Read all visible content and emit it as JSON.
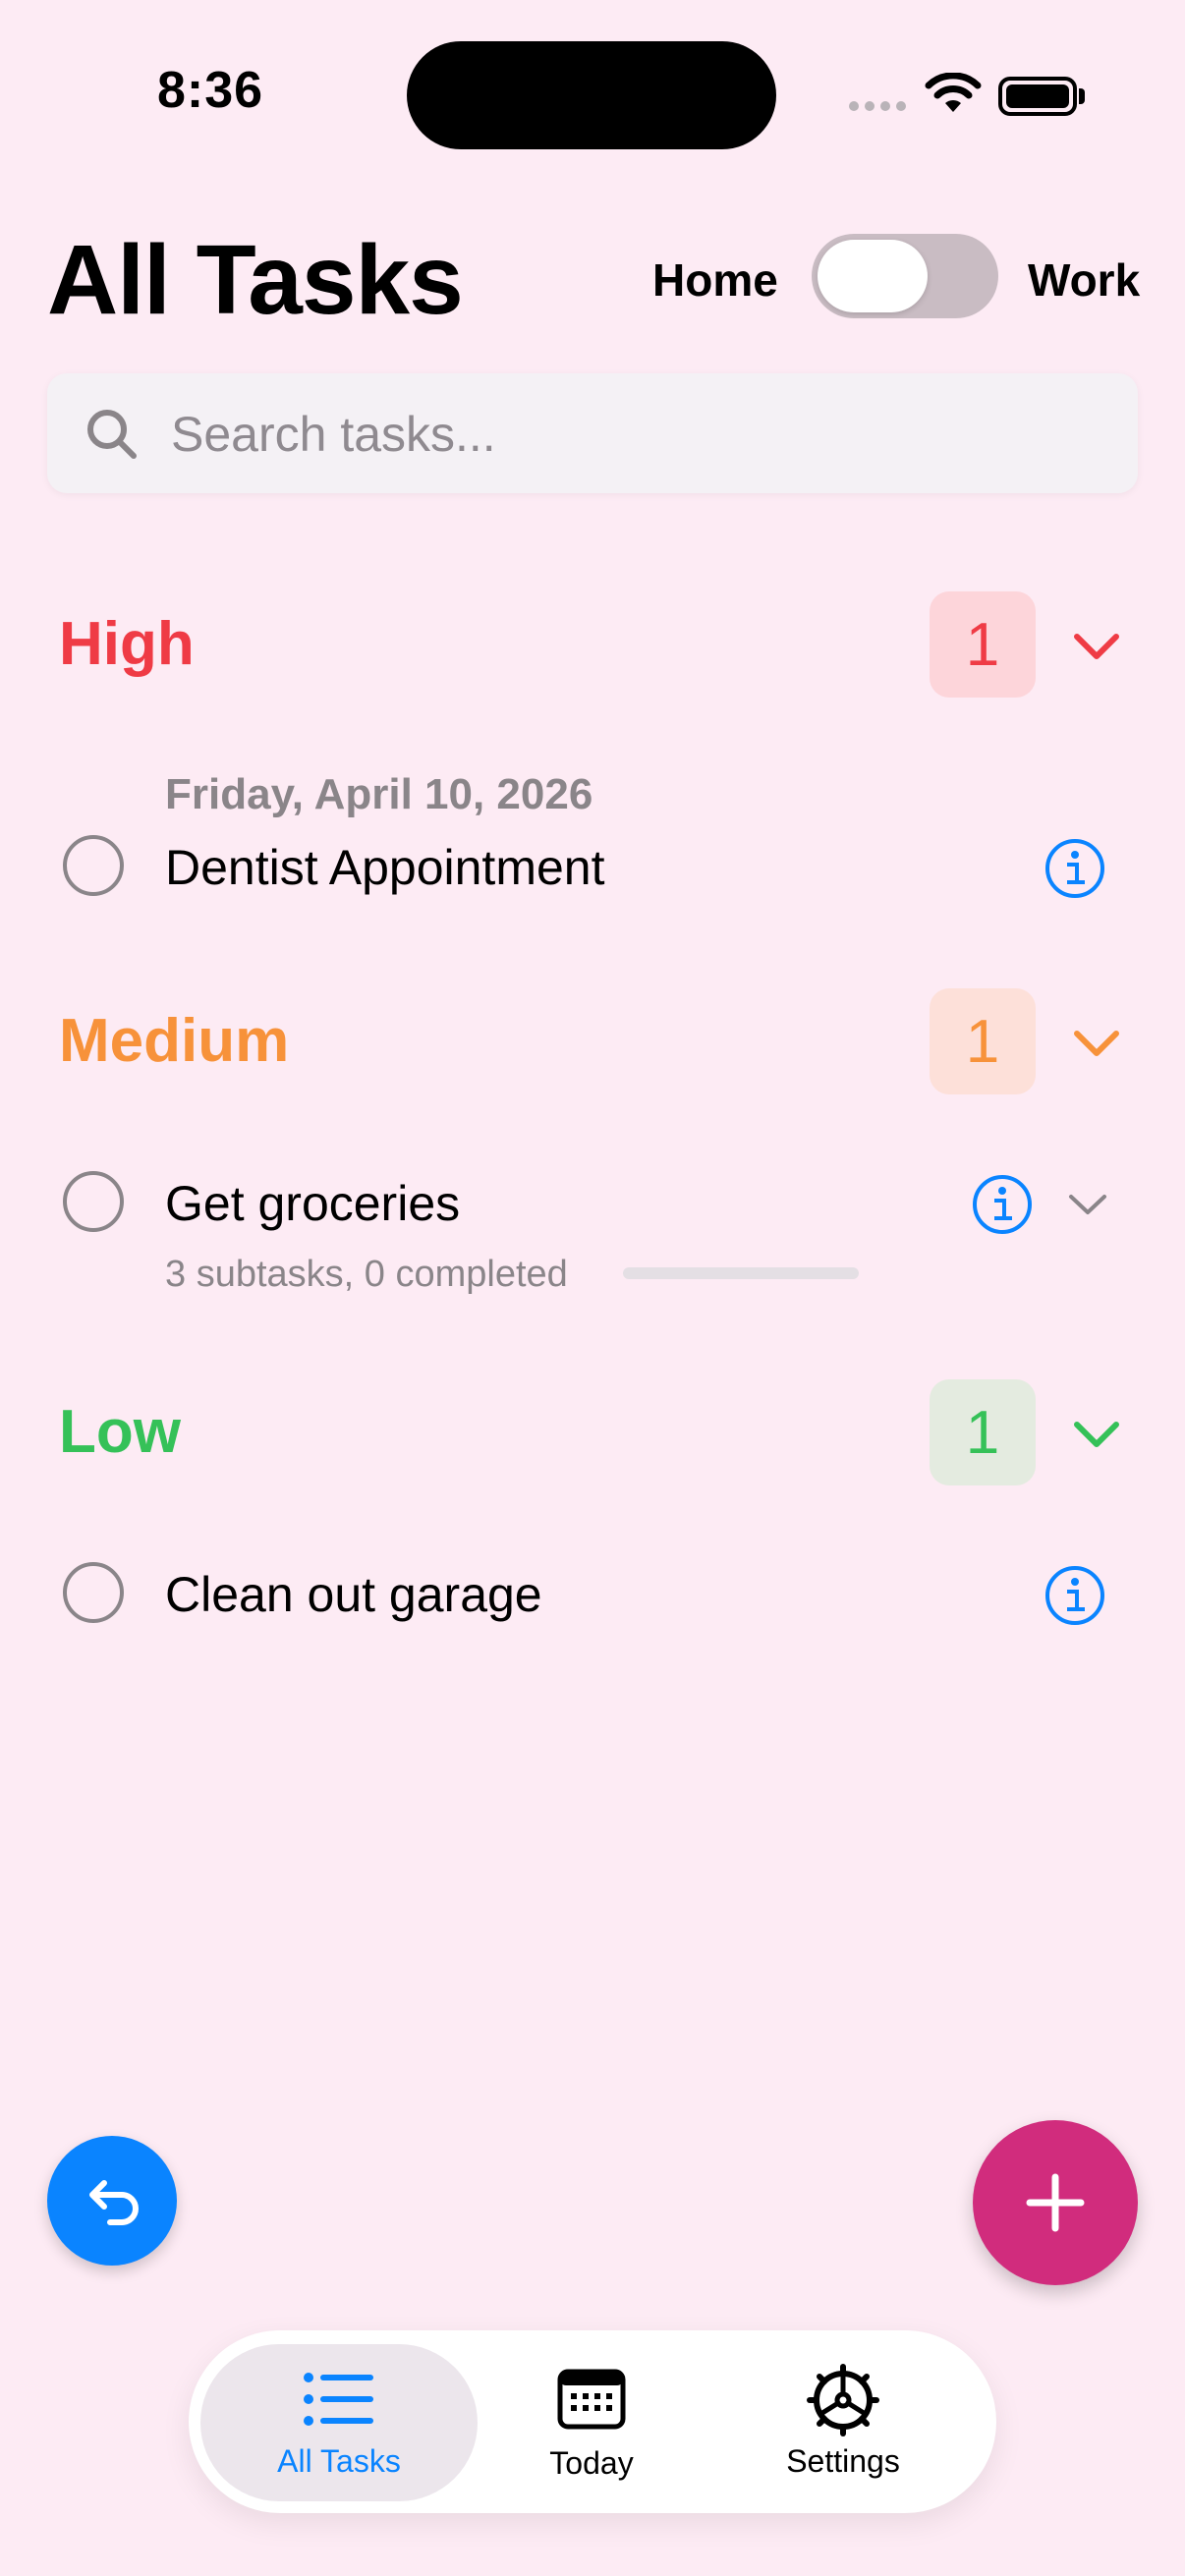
{
  "status_bar": {
    "time": "8:36"
  },
  "header": {
    "title": "All Tasks",
    "mode_left": "Home",
    "mode_right": "Work",
    "mode_toggle_on": false
  },
  "search": {
    "placeholder": "Search tasks..."
  },
  "sections": [
    {
      "label": "High",
      "count": "1",
      "color": "#ef3b45",
      "badge_bg": "#fdd5da",
      "tasks": [
        {
          "date": "Friday, April 10, 2026",
          "title": "Dentist Appointment"
        }
      ]
    },
    {
      "label": "Medium",
      "count": "1",
      "color": "#f7923a",
      "badge_bg": "#fde0d9",
      "tasks": [
        {
          "title": "Get groceries",
          "subtasks": "3 subtasks, 0 completed",
          "progress": 0
        }
      ]
    },
    {
      "label": "Low",
      "count": "1",
      "color": "#35c158",
      "badge_bg": "#e4ebe0",
      "tasks": [
        {
          "title": "Clean out garage"
        }
      ]
    }
  ],
  "tabs": [
    {
      "label": "All Tasks",
      "icon": "list-icon",
      "active": true
    },
    {
      "label": "Today",
      "icon": "calendar-icon",
      "active": false
    },
    {
      "label": "Settings",
      "icon": "gear-icon",
      "active": false
    }
  ],
  "colors": {
    "accent": "#0a84ff",
    "add_button": "#d12c7d",
    "background": "#fdebf4"
  }
}
